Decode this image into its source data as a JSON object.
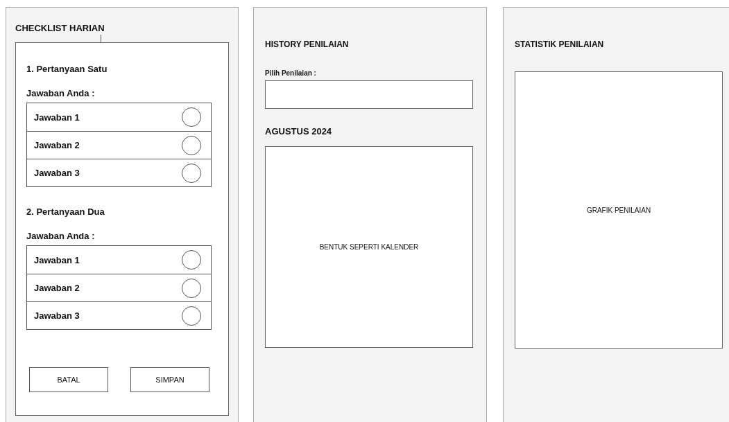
{
  "checklist": {
    "title": "CHECKLIST HARIAN",
    "questions": [
      {
        "question": "1. Pertanyaan Satu",
        "answer_label": "Jawaban Anda :",
        "options": [
          {
            "label": "Jawaban 1",
            "selected": false
          },
          {
            "label": "Jawaban 2",
            "selected": false
          },
          {
            "label": "Jawaban 3",
            "selected": false
          }
        ]
      },
      {
        "question": "2. Pertanyaan Dua",
        "answer_label": "Jawaban Anda :",
        "options": [
          {
            "label": "Jawaban 1",
            "selected": false
          },
          {
            "label": "Jawaban 2",
            "selected": false
          },
          {
            "label": "Jawaban 3",
            "selected": false
          }
        ]
      }
    ],
    "buttons": [
      "BATAL",
      "SIMPAN"
    ]
  },
  "history": {
    "title": "HISTORY PENILAIAN",
    "select_label": "Pilih Penilaian :",
    "month": "AGUSTUS 2024",
    "calendar_placeholder": "BENTUK SEPERTI KALENDER"
  },
  "statistics": {
    "title": "STATISTIK PENILAIAN",
    "chart_placeholder": "GRAFIK PENILAIAN"
  }
}
